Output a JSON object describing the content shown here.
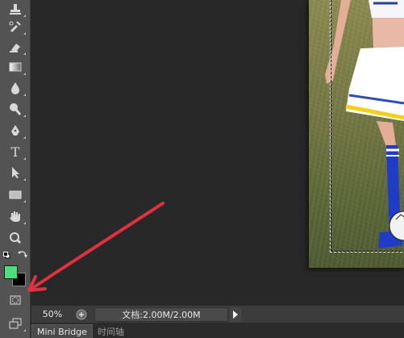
{
  "toolbar": {
    "tools": [
      {
        "name": "stamp-tool-icon"
      },
      {
        "name": "history-brush-tool-icon"
      },
      {
        "name": "eraser-tool-icon"
      },
      {
        "name": "gradient-tool-icon"
      },
      {
        "name": "blur-tool-icon"
      },
      {
        "name": "dodge-tool-icon"
      },
      {
        "name": "pen-tool-icon"
      },
      {
        "name": "type-tool-icon",
        "glyph": "T"
      },
      {
        "name": "path-selection-tool-icon"
      },
      {
        "name": "rectangle-tool-icon"
      },
      {
        "name": "hand-tool-icon"
      },
      {
        "name": "zoom-tool-icon"
      }
    ],
    "foreground_color": "#4be07a",
    "background_color": "#000000"
  },
  "status": {
    "zoom": "50%",
    "doc_info": "文档:2.00M/2.00M"
  },
  "panel_tabs": [
    {
      "label": "Mini Bridge"
    },
    {
      "label": "时间轴"
    }
  ],
  "annotation": {
    "color": "#e0313e"
  }
}
